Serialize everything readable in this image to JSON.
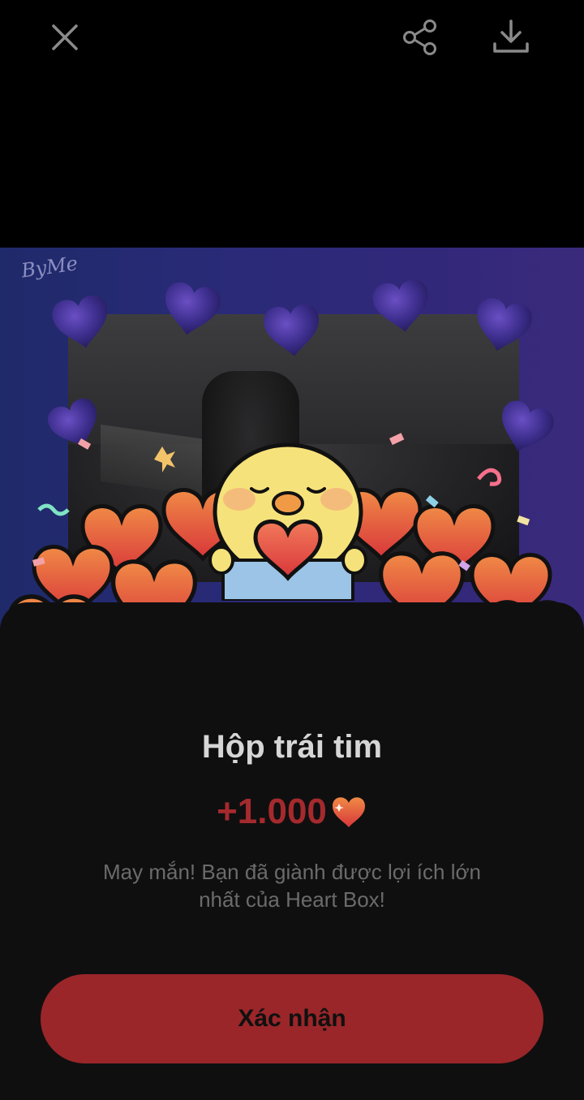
{
  "topbar": {
    "icons": [
      "close-icon",
      "share-icon",
      "download-icon"
    ]
  },
  "viewer": {
    "signature": "ByMe"
  },
  "dialog": {
    "title": "Hộp trái tim",
    "reward_amount": "+1.000",
    "reward_icon": "heart-icon",
    "description": "May mắn! Bạn đã giành được lợi ích lớn nhất của Heart Box!",
    "confirm_label": "Xác nhận"
  },
  "colors": {
    "background": "#000000",
    "sheet": "#0f0f10",
    "accent": "#9a2629",
    "reward_text": "#a42a2d",
    "heart": "#e5553f",
    "purple_heart": "#3c2f86"
  }
}
